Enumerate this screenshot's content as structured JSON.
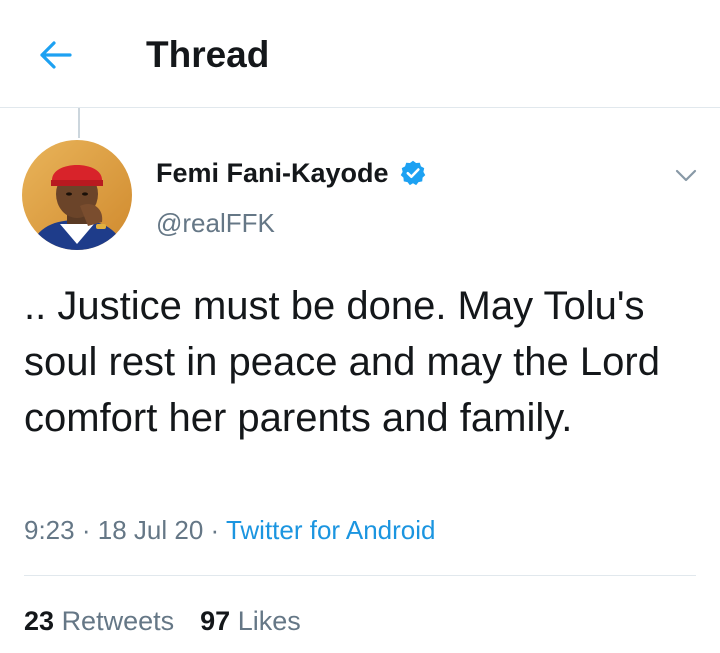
{
  "header": {
    "title": "Thread",
    "back_icon": "arrow-left-icon",
    "accent_color": "#1da1f2"
  },
  "tweet": {
    "author": {
      "name": "Femi Fani-Kayode",
      "handle": "@realFFK",
      "verified": true,
      "verified_icon": "verified-badge-icon"
    },
    "text": ".. Justice must be done. May Tolu's soul rest in peace and may the Lord comfort her parents and family.",
    "time": "9:23",
    "date": "18 Jul 20",
    "separator": "·",
    "source": "Twitter for Android",
    "more_icon": "chevron-down-icon"
  },
  "stats": {
    "retweets_count": "23",
    "retweets_label": "Retweets",
    "likes_count": "97",
    "likes_label": "Likes"
  },
  "colors": {
    "link": "#1b95e0",
    "muted": "#657786",
    "text": "#14171a",
    "border": "#e1e8ed"
  }
}
